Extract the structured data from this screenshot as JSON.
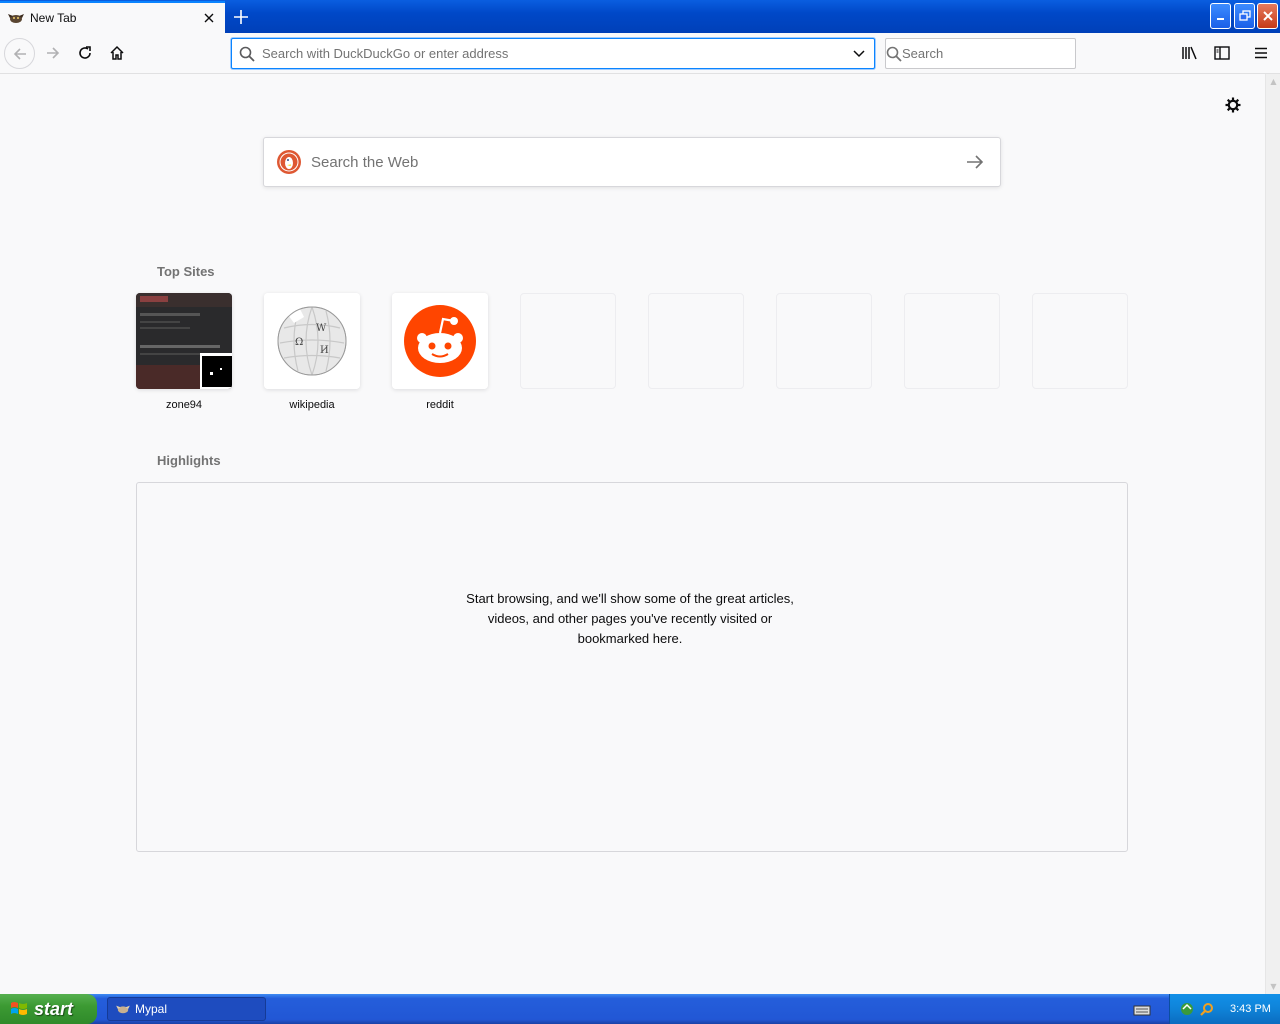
{
  "browser": {
    "tab": {
      "title": "New Tab",
      "close_icon": "close-icon"
    },
    "new_tab_icon": "plus-icon",
    "window_controls": [
      "minimize",
      "maximize",
      "close"
    ]
  },
  "toolbar": {
    "urlbar": {
      "placeholder": "Search with DuckDuckGo or enter address"
    },
    "searchbar": {
      "placeholder": "Search"
    }
  },
  "newtab": {
    "web_search": {
      "placeholder": "Search the Web"
    },
    "top_sites_title": "Top Sites",
    "top_sites": [
      {
        "label": "zone94"
      },
      {
        "label": "wikipedia"
      },
      {
        "label": "reddit"
      }
    ],
    "highlights_title": "Highlights",
    "highlights_empty_line1": "Start browsing, and we'll show some of the great articles,",
    "highlights_empty_line2": "videos, and other pages you've recently visited or",
    "highlights_empty_line3": "bookmarked here."
  },
  "taskbar": {
    "start_label": "start",
    "task_label": "Mypal",
    "clock": "3:43 PM"
  },
  "colors": {
    "accent": "#0a84ff",
    "reddit": "#ff4500",
    "xp_blue": "#245edb",
    "xp_green": "#3c9a33"
  }
}
